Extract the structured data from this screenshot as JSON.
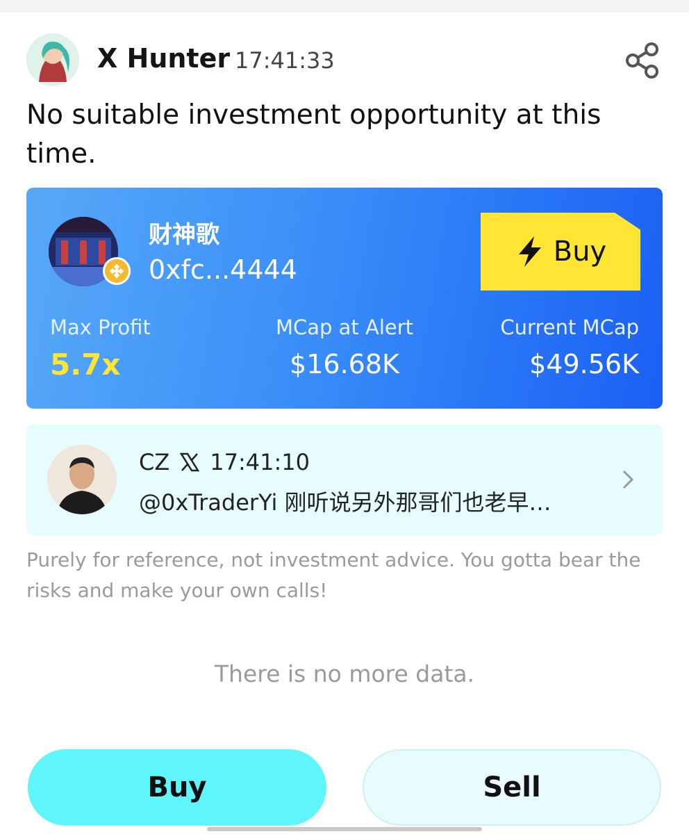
{
  "post": {
    "author": "X Hunter",
    "time": "17:41:33",
    "text": "No suitable investment opportunity at this time."
  },
  "token": {
    "name": "财神歌",
    "address": "0xfc...4444",
    "buy_label": "Buy",
    "stats": [
      {
        "label": "Max Profit",
        "value": "5.7x"
      },
      {
        "label": "MCap at Alert",
        "value": "$16.68K"
      },
      {
        "label": "Current MCap",
        "value": "$49.56K"
      }
    ]
  },
  "tweet": {
    "author": "CZ",
    "platform_icon": "x-logo-icon",
    "time": "17:41:10",
    "text": "@0xTraderYi 刚听说另外那哥们也老早…"
  },
  "disclaimer": "Purely for reference, not investment advice. You gotta bear the risks and make your own calls!",
  "empty_state": "There is no more data.",
  "actions": {
    "buy_label": "Buy",
    "sell_label": "Sell"
  },
  "colors": {
    "card_gradient_start": "#57a9f7",
    "card_gradient_end": "#1a60f4",
    "buy_accent": "#ffe534",
    "profit_color": "#ffe534",
    "buy_button": "#5ef5fb",
    "sell_button": "#e9fcfd",
    "tweet_bg": "#e6fcfd"
  }
}
